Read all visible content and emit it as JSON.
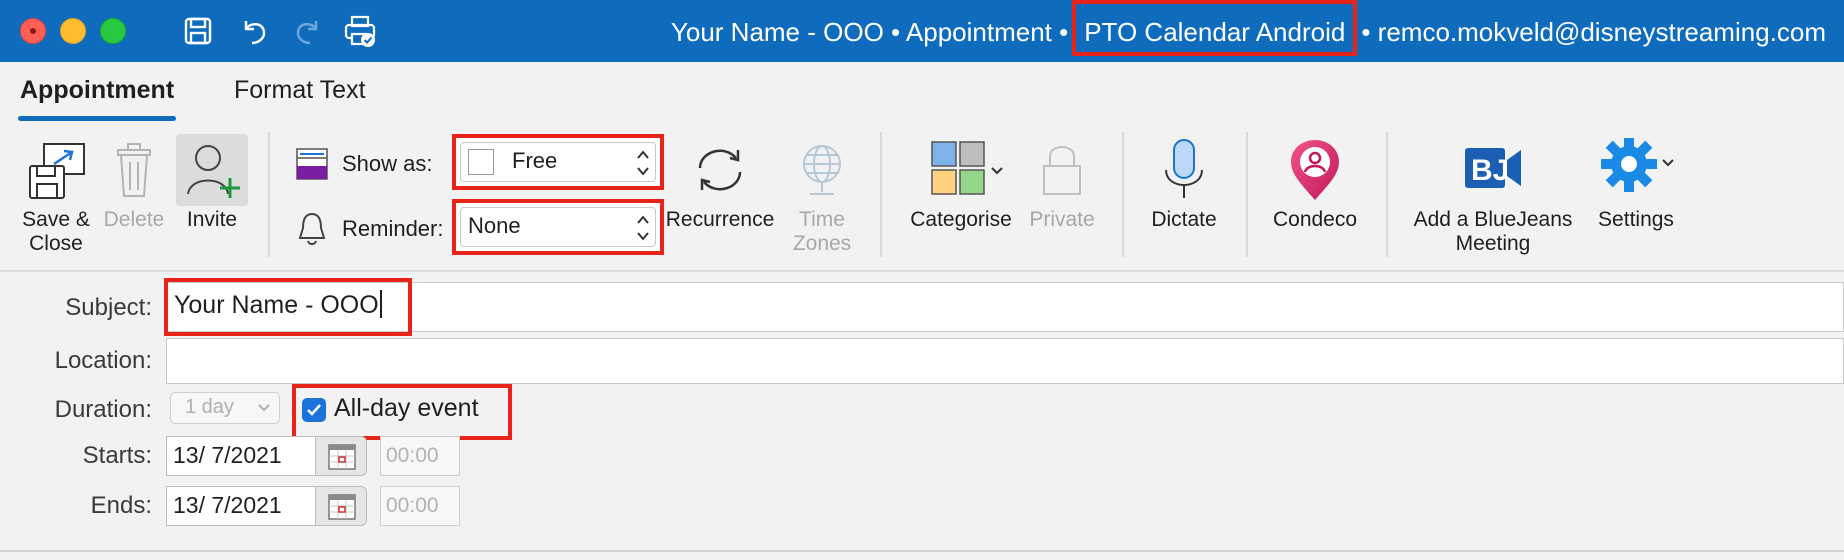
{
  "window": {
    "title_prefix": "Your Name - OOO • Appointment •",
    "title_calendar": "PTO Calendar Android",
    "title_suffix": "• remco.mokveld@disneystreaming.com"
  },
  "tabs": [
    {
      "label": "Appointment",
      "active": true
    },
    {
      "label": "Format Text",
      "active": false
    }
  ],
  "ribbon": {
    "save_close": "Save &\nClose",
    "delete": "Delete",
    "invite": "Invite",
    "show_as_label": "Show as:",
    "show_as_value": "Free",
    "reminder_label": "Reminder:",
    "reminder_value": "None",
    "recurrence": "Recurrence",
    "time_zones": "Time\nZones",
    "categorise": "Categorise",
    "private": "Private",
    "dictate": "Dictate",
    "condeco": "Condeco",
    "bluejeans": "Add a BlueJeans\nMeeting",
    "settings": "Settings"
  },
  "form": {
    "subject_label": "Subject:",
    "subject_value": "Your Name - OOO",
    "location_label": "Location:",
    "location_value": "",
    "duration_label": "Duration:",
    "duration_value": "1 day",
    "all_day_label": "All-day event",
    "all_day_checked": true,
    "starts_label": "Starts:",
    "starts_date": "13/  7/2021",
    "starts_time": "00:00",
    "ends_label": "Ends:",
    "ends_date": "13/  7/2021",
    "ends_time": "00:00"
  },
  "colors": {
    "titlebar": "#0f6cbd",
    "highlight": "#e8231a",
    "accent": "#1a73d9"
  }
}
